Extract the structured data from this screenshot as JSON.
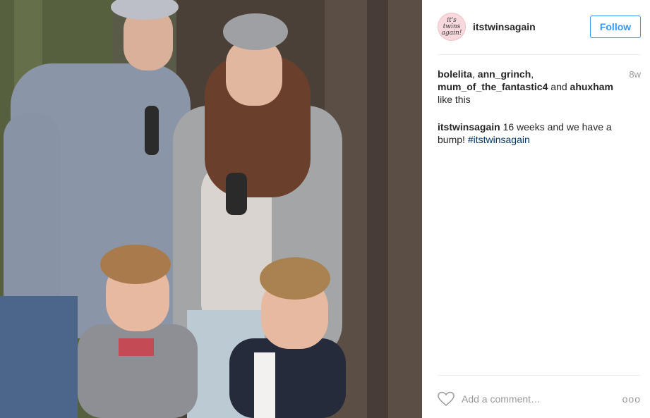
{
  "post": {
    "photo_alt": "Family of four standing in front of a tree trunk in the forest",
    "username": "itstwinsagain",
    "avatar_text": "it's twins again!",
    "follow_label": "Follow",
    "time_ago": "8w",
    "likes": {
      "users": [
        "bolelita",
        "ann_grinch",
        "mum_of_the_fantastic4",
        "ahuxham"
      ],
      "sep1": ", ",
      "sep2": ",",
      "and_text": " and ",
      "suffix": "like this"
    },
    "caption": {
      "user": "itstwinsagain",
      "text": " 16 weeks and we have a bump! ",
      "hashtag": "#itstwinsagain"
    },
    "comment_placeholder": "Add a comment…",
    "more_options": "ooo"
  },
  "colors": {
    "accent": "#3897f0",
    "hashtag": "#003569",
    "muted": "#999999",
    "text": "#262626"
  }
}
